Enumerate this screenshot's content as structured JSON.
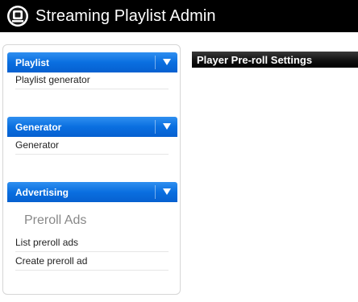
{
  "app": {
    "title": "Streaming Playlist Admin",
    "logo": "playlist-logo-icon"
  },
  "sidebar": {
    "sections": [
      {
        "title": "Playlist",
        "icon": "chevron-down-icon",
        "items": [
          "Playlist generator"
        ]
      },
      {
        "title": "Generator",
        "icon": "chevron-down-icon",
        "items": [
          "Generator"
        ]
      },
      {
        "title": "Advertising",
        "icon": "chevron-down-icon",
        "subheading": "Preroll Ads",
        "items": [
          "List preroll ads",
          "Create preroll ad"
        ]
      }
    ]
  },
  "main": {
    "title": "Player Pre-roll Settings"
  },
  "colors": {
    "accent": "#0a6fe0",
    "topbar": "#000000"
  }
}
